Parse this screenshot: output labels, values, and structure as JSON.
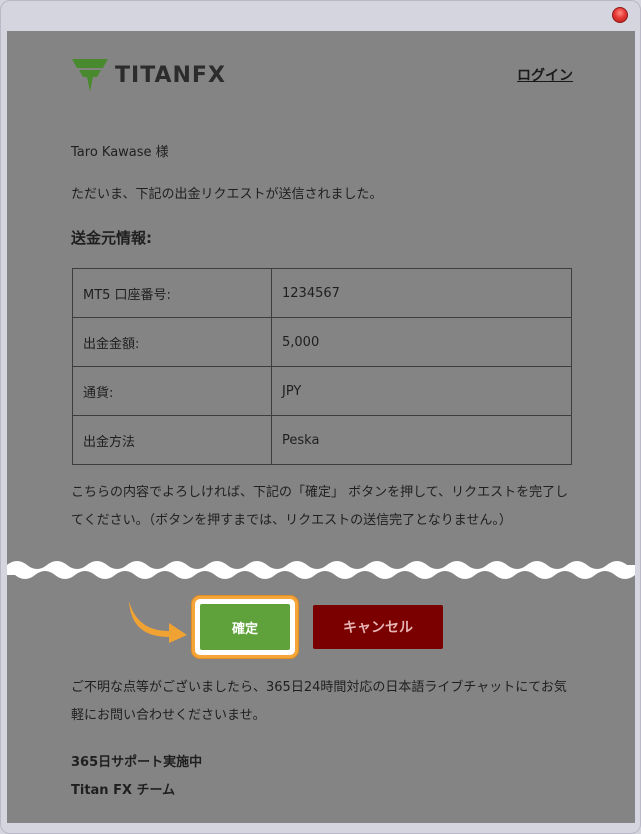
{
  "header": {
    "logo_text": "TITANFX",
    "login_label": "ログイン"
  },
  "email": {
    "greeting": "Taro Kawase 様",
    "intro": "ただいま、下記の出金リクエストが送信されました。",
    "section_title": "送金元情報:",
    "rows": [
      {
        "label": "MT5 口座番号:",
        "value": "1234567"
      },
      {
        "label": "出金金額:",
        "value": "5,000"
      },
      {
        "label": "通貨:",
        "value": "JPY"
      },
      {
        "label": "出金方法",
        "value": "Peska"
      }
    ],
    "confirm_text": "こちらの内容でよろしければ、下記の「確定」 ボタンを押して、リクエストを完了してください。（ボタンを押すまでは、リクエストの送信完了となりません。）",
    "confirm_button": "確定",
    "cancel_button": "キャンセル",
    "help_text": "ご不明な点等がございましたら、365日24時間対応の日本語ライブチャットにてお気軽にお問い合わせくださいませ。",
    "signature_line1": "365日サポート実施中",
    "signature_line2": "Titan FX チーム"
  },
  "colors": {
    "confirm_green": "#5fa13a",
    "cancel_red": "#7a0000",
    "highlight_orange": "#f5a53a",
    "logo_green": "#4a8a2e"
  }
}
